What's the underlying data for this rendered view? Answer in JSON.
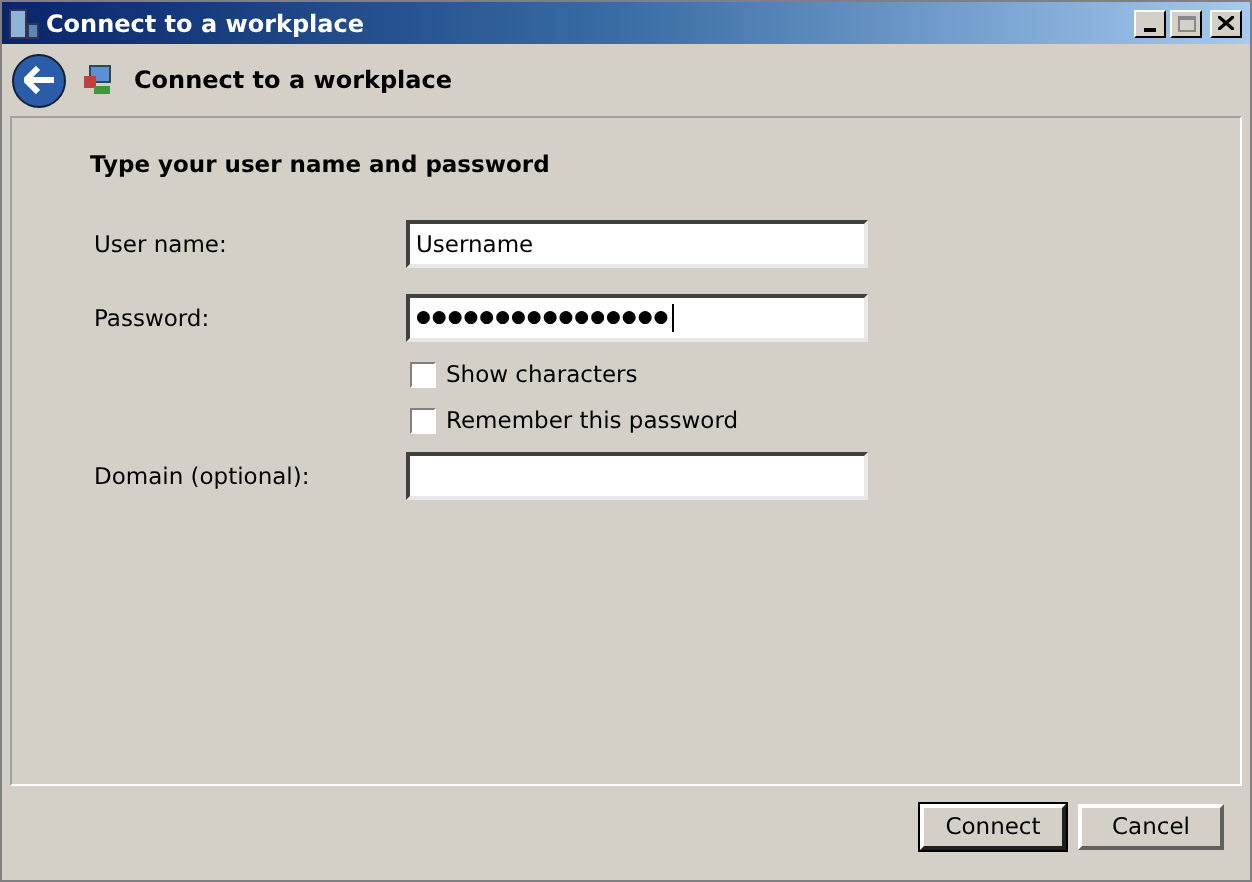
{
  "window": {
    "title": "Connect to a workplace"
  },
  "header": {
    "title": "Connect to a workplace"
  },
  "heading": "Type your user name and password",
  "fields": [
    {
      "label": "User name:",
      "value": "Username",
      "focused": false
    },
    {
      "label": "Password:",
      "value": "●●●●●●●●●●●●●●●●",
      "focused": true
    }
  ],
  "checkboxes": [
    {
      "label": "Show characters",
      "checked": false
    },
    {
      "label": "Remember this password",
      "checked": false
    }
  ],
  "domain": {
    "label": "Domain (optional):"
  },
  "buttons": [
    {
      "label": "Connect",
      "default": true
    },
    {
      "label": "Cancel",
      "default": false
    }
  ]
}
